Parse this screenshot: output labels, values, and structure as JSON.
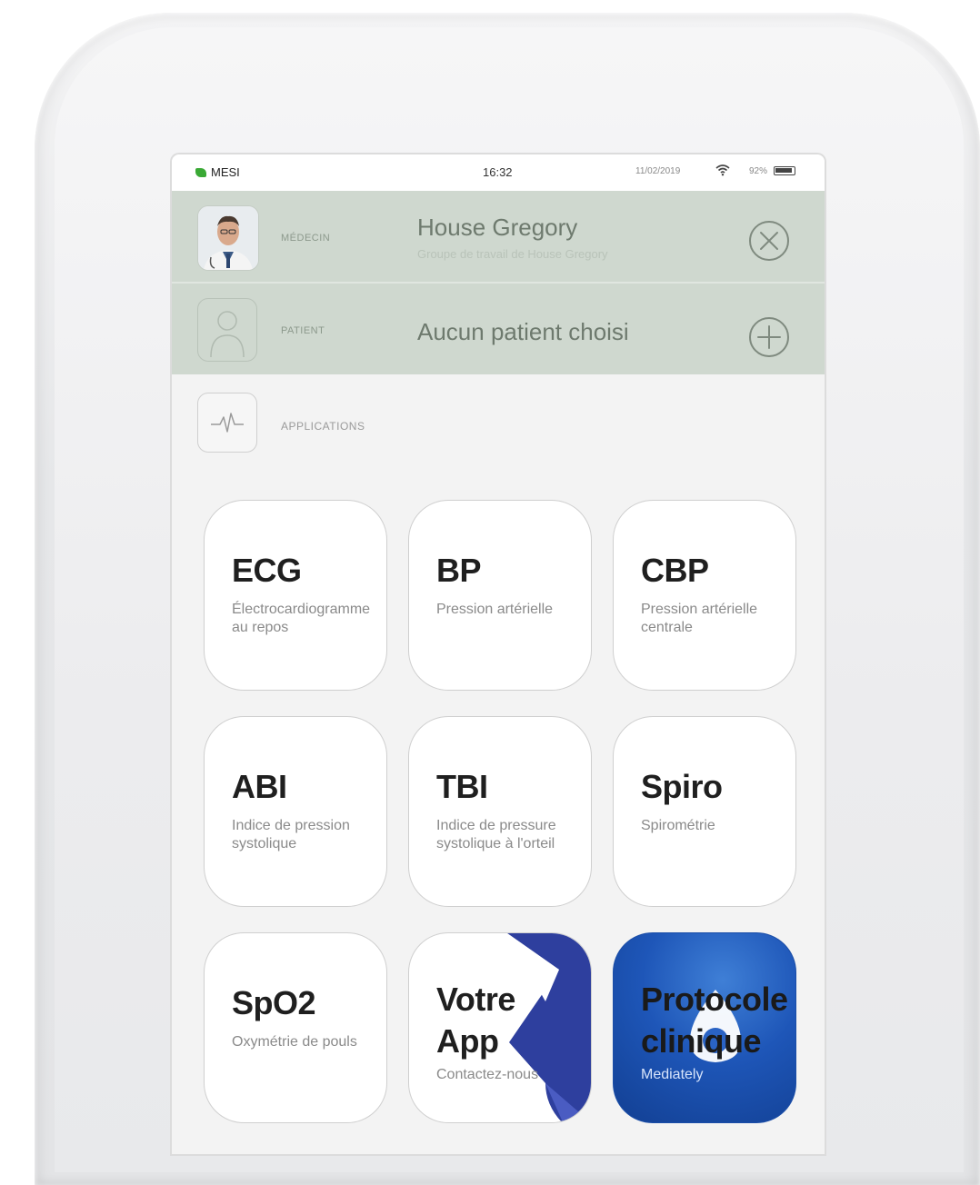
{
  "status_bar": {
    "brand": "MESI",
    "time": "16:32",
    "date": "11/02/2019",
    "battery": "92%"
  },
  "doctor": {
    "label": "MÉDECIN",
    "name": "House Gregory",
    "group": "Groupe de travail de House Gregory"
  },
  "patient": {
    "label": "PATIENT",
    "name": "Aucun patient choisi"
  },
  "applications": {
    "label": "APPLICATIONS",
    "tiles": [
      {
        "title": "ECG",
        "desc": "Électrocardiogramme au repos"
      },
      {
        "title": "BP",
        "desc": "Pression artérielle"
      },
      {
        "title": "CBP",
        "desc": "Pression artérielle centrale"
      },
      {
        "title": "ABI",
        "desc": "Indice de pression systolique"
      },
      {
        "title": "TBI",
        "desc": "Indice de pressure systolique à l'orteil"
      },
      {
        "title": "Spiro",
        "desc": "Spirométrie"
      },
      {
        "title": "SpO2",
        "desc": "Oxymétrie de pouls"
      },
      {
        "title": "Votre App",
        "desc": "Contactez-nous"
      },
      {
        "title": "Protocole clinique",
        "desc": "Mediately"
      }
    ]
  },
  "colors": {
    "header_row_bg": "#cfd8cf",
    "screen_bg": "#f3f3f3",
    "votre_app_accent": "#2e3f9e",
    "protocole_blue": "#1e56b8",
    "brand_green": "#3aa935"
  },
  "icons": {
    "doctor_action": "close-circle-icon",
    "patient_action": "add-circle-icon",
    "patient_avatar": "person-outline-icon",
    "applications": "heartbeat-icon",
    "wifi": "wifi-icon",
    "battery": "battery-icon"
  }
}
